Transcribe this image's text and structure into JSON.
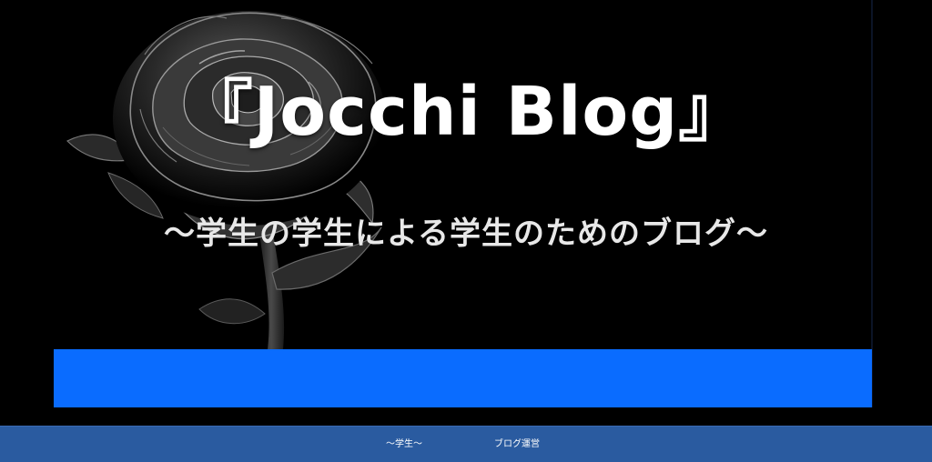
{
  "header": {
    "title": "『Jocchi Blog』",
    "tagline": "〜学生の学生による学生のためのブログ〜"
  },
  "nav": {
    "items": [
      {
        "label": "〜学生〜"
      },
      {
        "label": "ブログ運営"
      }
    ]
  },
  "colors": {
    "background": "#000000",
    "accent_band": "#0a6cff",
    "nav_bar": "#2a5ba0",
    "title_text": "#ffffff"
  },
  "icons": {
    "hero_image": "black-rose-image"
  }
}
